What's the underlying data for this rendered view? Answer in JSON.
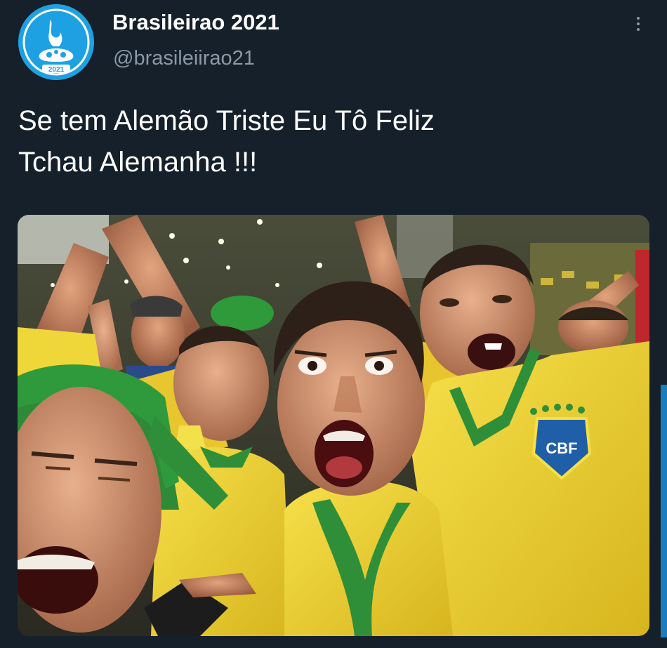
{
  "tweet": {
    "author": {
      "display_name": "Brasileirao 2021",
      "handle": "@brasileiirao21",
      "avatar_icon": "brasileirao-2021-logo-icon",
      "avatar_color": "#1ea1e3"
    },
    "text_lines": [
      "Se tem Alemão Triste Eu Tô Feliz",
      "Tchau Alemanha !!!"
    ],
    "more_icon": "vertical-ellipsis-icon"
  },
  "theme": {
    "background": "#15202b",
    "secondary_text": "#8b98a5",
    "accent": "#1d9bf0"
  }
}
